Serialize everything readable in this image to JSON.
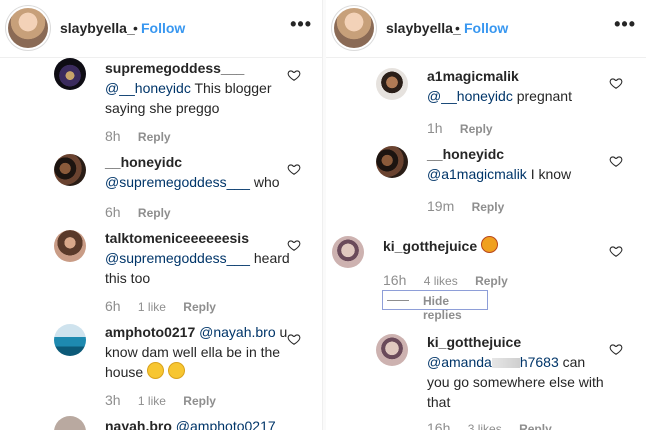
{
  "left": {
    "header": {
      "username": "slaybyella_",
      "dot": "•",
      "follow": "Follow",
      "more": "•••"
    },
    "comments": [
      {
        "username": "supremegoddess___",
        "mention": "@__honeyidc",
        "text": " This blogger saying she preggo",
        "time": "8h",
        "likes": "",
        "reply": "Reply"
      },
      {
        "username": "__honeyidc",
        "mention": "@supremegoddess___",
        "text": " who",
        "time": "6h",
        "likes": "",
        "reply": "Reply"
      },
      {
        "username": "talktomeniceeeeeesis",
        "mention": "@supremegoddess___",
        "text": " heard this too",
        "time": "6h",
        "likes": "1 like",
        "reply": "Reply"
      },
      {
        "username": "amphoto0217",
        "mention": "@nayah.bro",
        "text": " u know dam well ella be in the house",
        "time": "3h",
        "likes": "1 like",
        "reply": "Reply"
      },
      {
        "username": "nayah.bro",
        "mention": "@amphoto0217",
        "text": "",
        "time": "",
        "likes": "",
        "reply": ""
      }
    ]
  },
  "right": {
    "header": {
      "username": "slaybyella_",
      "dot": "•",
      "follow": "Follow",
      "more": "•••"
    },
    "comments": [
      {
        "username": "a1magicmalik",
        "mention": "@__honeyidc",
        "text": " pregnant",
        "time": "1h",
        "likes": "",
        "reply": "Reply"
      },
      {
        "username": "__honeyidc",
        "mention": "@a1magicmalik",
        "text": " I know",
        "time": "19m",
        "likes": "",
        "reply": "Reply"
      },
      {
        "username": "ki_gotthejuice",
        "mention": "",
        "text": "",
        "time": "16h",
        "likes": "4 likes",
        "reply": "Reply"
      },
      {
        "username": "ki_gotthejuice",
        "mention": "@amanda",
        "text": " can you go somewhere else with that",
        "time": "16h",
        "likes": "3 likes",
        "reply": "Reply"
      }
    ],
    "mention_tail": "h7683",
    "hide_replies": "Hide replies"
  },
  "icons": {
    "heart": "heart-outline-icon",
    "more": "more-dots-icon"
  },
  "colors": {
    "link": "#3897f0",
    "mention": "#003569",
    "meta": "#8e8e8e",
    "text": "#262626",
    "divider": "#efefef"
  }
}
